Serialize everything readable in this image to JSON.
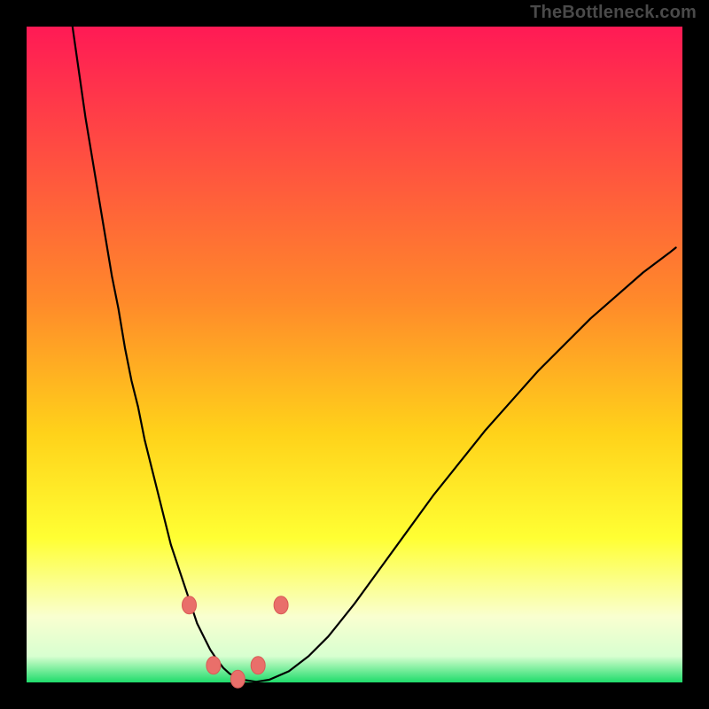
{
  "watermark": "TheBottleneck.com",
  "colors": {
    "black": "#000000",
    "grad_top": "#ff1a55",
    "grad_mid1": "#ff7a2a",
    "grad_mid2": "#ffd21a",
    "grad_mid3": "#ffff33",
    "grad_mid4": "#f4ffb0",
    "grad_bottom": "#1fdc6b",
    "curve": "#000000",
    "marker_fill": "#e96f6a",
    "marker_stroke": "#d85a55"
  },
  "chart_data": {
    "type": "line",
    "title": "",
    "xlabel": "",
    "ylabel": "",
    "xlim": [
      0,
      100
    ],
    "ylim": [
      0,
      100
    ],
    "x": [
      7,
      8,
      9,
      10,
      11,
      12,
      13,
      14,
      15,
      16,
      17,
      18,
      19,
      20,
      21,
      22,
      23,
      24,
      25,
      26,
      27,
      28,
      29,
      30,
      31,
      33,
      35,
      37,
      40,
      43,
      46,
      50,
      54,
      58,
      62,
      66,
      70,
      74,
      78,
      82,
      86,
      90,
      94,
      98,
      99
    ],
    "y": [
      100,
      93,
      86,
      80,
      74,
      68,
      62,
      57,
      51,
      46,
      42,
      37,
      33,
      29,
      25,
      21,
      18,
      15,
      12,
      9,
      7,
      5,
      3.5,
      2.2,
      1.3,
      0.4,
      0.1,
      0.4,
      1.7,
      4,
      7,
      12,
      17.5,
      23,
      28.5,
      33.5,
      38.5,
      43,
      47.5,
      51.5,
      55.5,
      59,
      62.5,
      65.5,
      66.3
    ],
    "markers": [
      {
        "x": 24.8,
        "y": 11.8
      },
      {
        "x": 28.5,
        "y": 2.6
      },
      {
        "x": 32.2,
        "y": 0.5
      },
      {
        "x": 35.3,
        "y": 2.6
      },
      {
        "x": 38.8,
        "y": 11.8
      }
    ]
  },
  "layout": {
    "outer_size": 800,
    "inner_x": 30,
    "inner_y": 30,
    "inner_w": 740,
    "inner_h": 740
  }
}
